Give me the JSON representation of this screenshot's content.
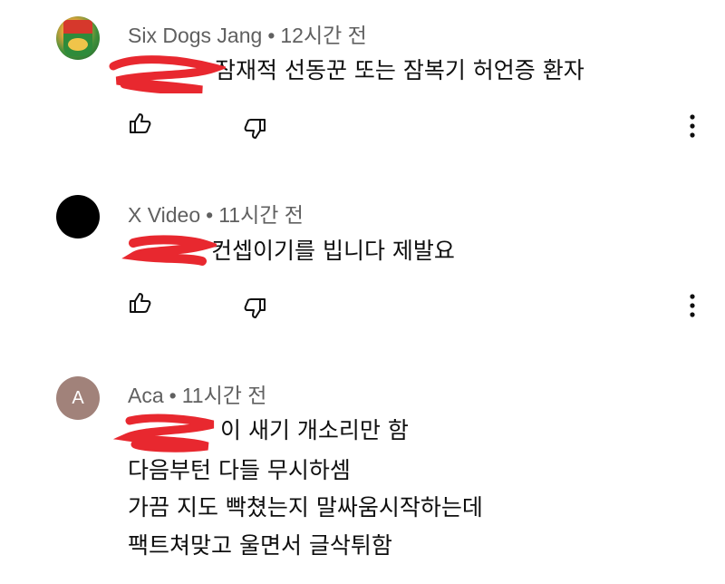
{
  "comments": [
    {
      "avatar": "ramen-cup-image",
      "author": "Six Dogs Jang",
      "separator": "•",
      "time": "12시간 전",
      "text_lines": [
        "잠재적 선동꾼 또는 잠복기 허언증 환자"
      ],
      "like_icon": "thumbs-up-icon",
      "dislike_icon": "thumbs-down-icon",
      "menu_icon": "more-vert-icon"
    },
    {
      "avatar": "black-circle",
      "author": "X Video",
      "separator": "•",
      "time": "11시간 전",
      "text_lines": [
        "컨셉이기를 빕니다 제발요"
      ],
      "like_icon": "thumbs-up-icon",
      "dislike_icon": "thumbs-down-icon",
      "menu_icon": "more-vert-icon"
    },
    {
      "avatar_letter": "A",
      "author": "Aca",
      "separator": "•",
      "time": "11시간 전",
      "text_lines": [
        "이 새기 개소리만 함",
        "다음부턴 다들 무시하셈",
        "가끔 지도 빡쳤는지 말싸움시작하는데",
        "팩트쳐맞고 울면서 글삭튀함"
      ]
    }
  ],
  "colors": {
    "meta_text": "#606060",
    "body_text": "#0f0f0f",
    "redaction": "#e8282f",
    "letter_avatar_bg": "#a1827a"
  }
}
